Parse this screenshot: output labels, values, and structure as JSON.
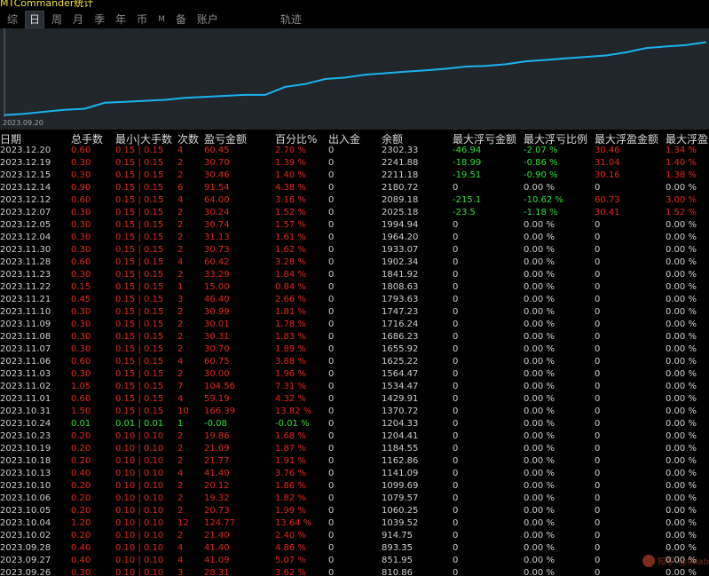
{
  "window": {
    "title": "MTCommander统计"
  },
  "tabs": [
    "综",
    "日",
    "周",
    "月",
    "季",
    "年",
    "币",
    "M",
    "备",
    "账户",
    "轨迹"
  ],
  "active_tab": "日",
  "chart": {
    "start_label": "2023.09.20",
    "line_color": "#1ab3f0"
  },
  "columns": [
    "日期",
    "总手数",
    "最小|大手数",
    "次数",
    "盈亏金额",
    "百分比%",
    "出入金",
    "余额",
    "最大浮亏金额",
    "最大浮亏比例",
    "最大浮盈金额",
    "最大浮盈"
  ],
  "rows": [
    [
      "2023.12.20",
      "0.60",
      "0.15 | 0.15",
      "4",
      "60.45",
      "2.70 %",
      "0",
      "2302.33",
      "-46.94",
      "-2.07 %",
      "30.46",
      "1.34 %"
    ],
    [
      "2023.12.19",
      "0.30",
      "0.15 | 0.15",
      "2",
      "30.70",
      "1.39 %",
      "0",
      "2241.88",
      "-18.99",
      "-0.86 %",
      "31.04",
      "1.40 %"
    ],
    [
      "2023.12.15",
      "0.30",
      "0.15 | 0.15",
      "2",
      "30.46",
      "1.40 %",
      "0",
      "2211.18",
      "-19.51",
      "-0.90 %",
      "30.16",
      "1.38 %"
    ],
    [
      "2023.12.14",
      "0.90",
      "0.15 | 0.15",
      "6",
      "91.54",
      "4.38 %",
      "0",
      "2180.72",
      "0",
      "0.00 %",
      "0",
      "0.00 %"
    ],
    [
      "2023.12.12",
      "0.60",
      "0.15 | 0.15",
      "4",
      "64.00",
      "3.16 %",
      "0",
      "2089.18",
      "-215.1",
      "-10.62 %",
      "60.73",
      "3.00 %"
    ],
    [
      "2023.12.07",
      "0.30",
      "0.15 | 0.15",
      "2",
      "30.24",
      "1.52 %",
      "0",
      "2025.18",
      "-23.5",
      "-1.18 %",
      "30.41",
      "1.52 %"
    ],
    [
      "2023.12.05",
      "0.30",
      "0.15 | 0.15",
      "2",
      "30.74",
      "1.57 %",
      "0",
      "1994.94",
      "0",
      "0.00 %",
      "0",
      "0.00 %"
    ],
    [
      "2023.12.04",
      "0.30",
      "0.15 | 0.15",
      "2",
      "31.13",
      "1.61 %",
      "0",
      "1964.20",
      "0",
      "0.00 %",
      "0",
      "0.00 %"
    ],
    [
      "2023.11.30",
      "0.30",
      "0.15 | 0.15",
      "2",
      "30.73",
      "1.62 %",
      "0",
      "1933.07",
      "0",
      "0.00 %",
      "0",
      "0.00 %"
    ],
    [
      "2023.11.28",
      "0.60",
      "0.15 | 0.15",
      "4",
      "60.42",
      "3.28 %",
      "0",
      "1902.34",
      "0",
      "0.00 %",
      "0",
      "0.00 %"
    ],
    [
      "2023.11.23",
      "0.30",
      "0.15 | 0.15",
      "2",
      "33.29",
      "1.84 %",
      "0",
      "1841.92",
      "0",
      "0.00 %",
      "0",
      "0.00 %"
    ],
    [
      "2023.11.22",
      "0.15",
      "0.15 | 0.15",
      "1",
      "15.00",
      "0.84 %",
      "0",
      "1808.63",
      "0",
      "0.00 %",
      "0",
      "0.00 %"
    ],
    [
      "2023.11.21",
      "0.45",
      "0.15 | 0.15",
      "3",
      "46.40",
      "2.66 %",
      "0",
      "1793.63",
      "0",
      "0.00 %",
      "0",
      "0.00 %"
    ],
    [
      "2023.11.10",
      "0.30",
      "0.15 | 0.15",
      "2",
      "30.99",
      "1.81 %",
      "0",
      "1747.23",
      "0",
      "0.00 %",
      "0",
      "0.00 %"
    ],
    [
      "2023.11.09",
      "0.30",
      "0.15 | 0.15",
      "2",
      "30.01",
      "1.78 %",
      "0",
      "1716.24",
      "0",
      "0.00 %",
      "0",
      "0.00 %"
    ],
    [
      "2023.11.08",
      "0.30",
      "0.15 | 0.15",
      "2",
      "30.31",
      "1.83 %",
      "0",
      "1686.23",
      "0",
      "0.00 %",
      "0",
      "0.00 %"
    ],
    [
      "2023.11.07",
      "0.30",
      "0.15 | 0.15",
      "2",
      "30.70",
      "1.89 %",
      "0",
      "1655.92",
      "0",
      "0.00 %",
      "0",
      "0.00 %"
    ],
    [
      "2023.11.06",
      "0.60",
      "0.15 | 0.15",
      "4",
      "60.75",
      "3.88 %",
      "0",
      "1625.22",
      "0",
      "0.00 %",
      "0",
      "0.00 %"
    ],
    [
      "2023.11.03",
      "0.30",
      "0.15 | 0.15",
      "2",
      "30.00",
      "1.96 %",
      "0",
      "1564.47",
      "0",
      "0.00 %",
      "0",
      "0.00 %"
    ],
    [
      "2023.11.02",
      "1.05",
      "0.15 | 0.15",
      "7",
      "104.56",
      "7.31 %",
      "0",
      "1534.47",
      "0",
      "0.00 %",
      "0",
      "0.00 %"
    ],
    [
      "2023.11.01",
      "0.60",
      "0.15 | 0.15",
      "4",
      "59.19",
      "4.32 %",
      "0",
      "1429.91",
      "0",
      "0.00 %",
      "0",
      "0.00 %"
    ],
    [
      "2023.10.31",
      "1.50",
      "0.15 | 0.15",
      "10",
      "166.39",
      "13.82 %",
      "0",
      "1370.72",
      "0",
      "0.00 %",
      "0",
      "0.00 %"
    ],
    [
      "2023.10.24",
      "0.01",
      "0.01 | 0.01",
      "1",
      "-0.08",
      "-0.01 %",
      "0",
      "1204.33",
      "0",
      "0.00 %",
      "0",
      "0.00 %"
    ],
    [
      "2023.10.23",
      "0.20",
      "0.10 | 0.10",
      "2",
      "19.86",
      "1.68 %",
      "0",
      "1204.41",
      "0",
      "0.00 %",
      "0",
      "0.00 %"
    ],
    [
      "2023.10.19",
      "0.20",
      "0.10 | 0.10",
      "2",
      "21.69",
      "1.87 %",
      "0",
      "1184.55",
      "0",
      "0.00 %",
      "0",
      "0.00 %"
    ],
    [
      "2023.10.18",
      "0.20",
      "0.10 | 0.10",
      "2",
      "21.77",
      "1.91 %",
      "0",
      "1162.86",
      "0",
      "0.00 %",
      "0",
      "0.00 %"
    ],
    [
      "2023.10.13",
      "0.40",
      "0.10 | 0.10",
      "4",
      "41.40",
      "3.76 %",
      "0",
      "1141.09",
      "0",
      "0.00 %",
      "0",
      "0.00 %"
    ],
    [
      "2023.10.10",
      "0.20",
      "0.10 | 0.10",
      "2",
      "20.12",
      "1.86 %",
      "0",
      "1099.69",
      "0",
      "0.00 %",
      "0",
      "0.00 %"
    ],
    [
      "2023.10.06",
      "0.20",
      "0.10 | 0.10",
      "2",
      "19.32",
      "1.82 %",
      "0",
      "1079.57",
      "0",
      "0.00 %",
      "0",
      "0.00 %"
    ],
    [
      "2023.10.05",
      "0.20",
      "0.10 | 0.10",
      "2",
      "20.73",
      "1.99 %",
      "0",
      "1060.25",
      "0",
      "0.00 %",
      "0",
      "0.00 %"
    ],
    [
      "2023.10.04",
      "1.20",
      "0.10 | 0.10",
      "12",
      "124.77",
      "13.64 %",
      "0",
      "1039.52",
      "0",
      "0.00 %",
      "0",
      "0.00 %"
    ],
    [
      "2023.10.02",
      "0.20",
      "0.10 | 0.10",
      "2",
      "21.40",
      "2.40 %",
      "0",
      "914.75",
      "0",
      "0.00 %",
      "0",
      "0.00 %"
    ],
    [
      "2023.09.28",
      "0.40",
      "0.10 | 0.10",
      "4",
      "41.40",
      "4.86 %",
      "0",
      "893.35",
      "0",
      "0.00 %",
      "0",
      "0.00 %"
    ],
    [
      "2023.09.27",
      "0.40",
      "0.10 | 0.10",
      "4",
      "41.09",
      "5.07 %",
      "0",
      "851.95",
      "0",
      "0.00 %",
      "0",
      "0.00 %"
    ],
    [
      "2023.09.26",
      "0.30",
      "0.10 | 0.10",
      "3",
      "28.31",
      "3.62 %",
      "0",
      "810.86",
      "0",
      "0.00 %",
      "0",
      "0.00 %"
    ]
  ],
  "watermark": {
    "text": "知乎 @fxlab"
  }
}
